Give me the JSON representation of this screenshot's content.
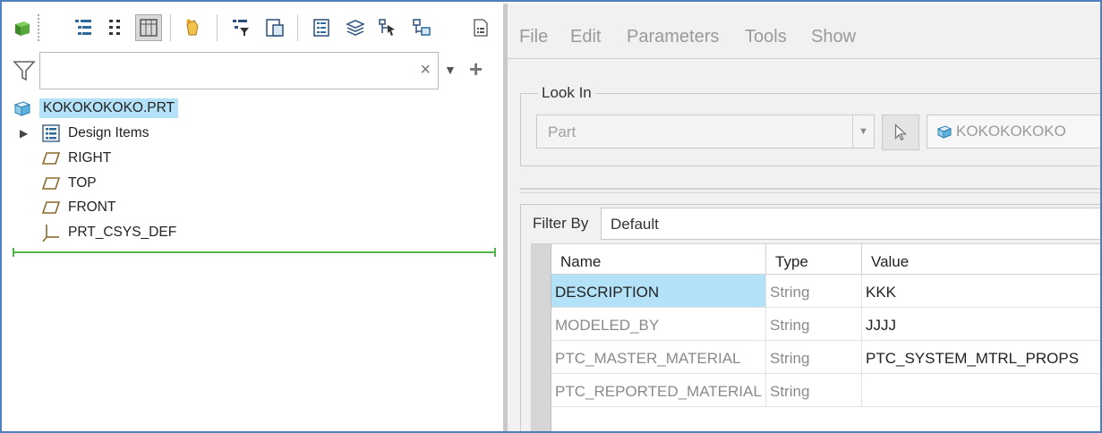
{
  "model_tree": {
    "search": {
      "value": "",
      "placeholder": ""
    },
    "root": "KOKOKOKOKO.PRT",
    "items": [
      {
        "label": "Design Items",
        "icon": "design-items-icon"
      },
      {
        "label": "RIGHT",
        "icon": "datum-plane-icon"
      },
      {
        "label": "TOP",
        "icon": "datum-plane-icon"
      },
      {
        "label": "FRONT",
        "icon": "datum-plane-icon"
      },
      {
        "label": "PRT_CSYS_DEF",
        "icon": "csys-icon"
      }
    ]
  },
  "parameters": {
    "menu": [
      "File",
      "Edit",
      "Parameters",
      "Tools",
      "Show"
    ],
    "look_in": {
      "legend": "Look In",
      "type": "Part",
      "object": "KOKOKOKOKO"
    },
    "filter_by": {
      "label": "Filter By",
      "value": "Default"
    },
    "columns": [
      "Name",
      "Type",
      "Value"
    ],
    "rows": [
      {
        "name": "DESCRIPTION",
        "type": "String",
        "value": "KKK"
      },
      {
        "name": "MODELED_BY",
        "type": "String",
        "value": "JJJJ"
      },
      {
        "name": "PTC_MASTER_MATERIAL",
        "type": "String",
        "value": "PTC_SYSTEM_MTRL_PROPS"
      },
      {
        "name": "PTC_REPORTED_MATERIAL",
        "type": "String",
        "value": ""
      }
    ]
  },
  "colors": {
    "selection": "#b3e1f7",
    "insert_line": "#53b449",
    "frame_border": "#4f7fbf"
  }
}
